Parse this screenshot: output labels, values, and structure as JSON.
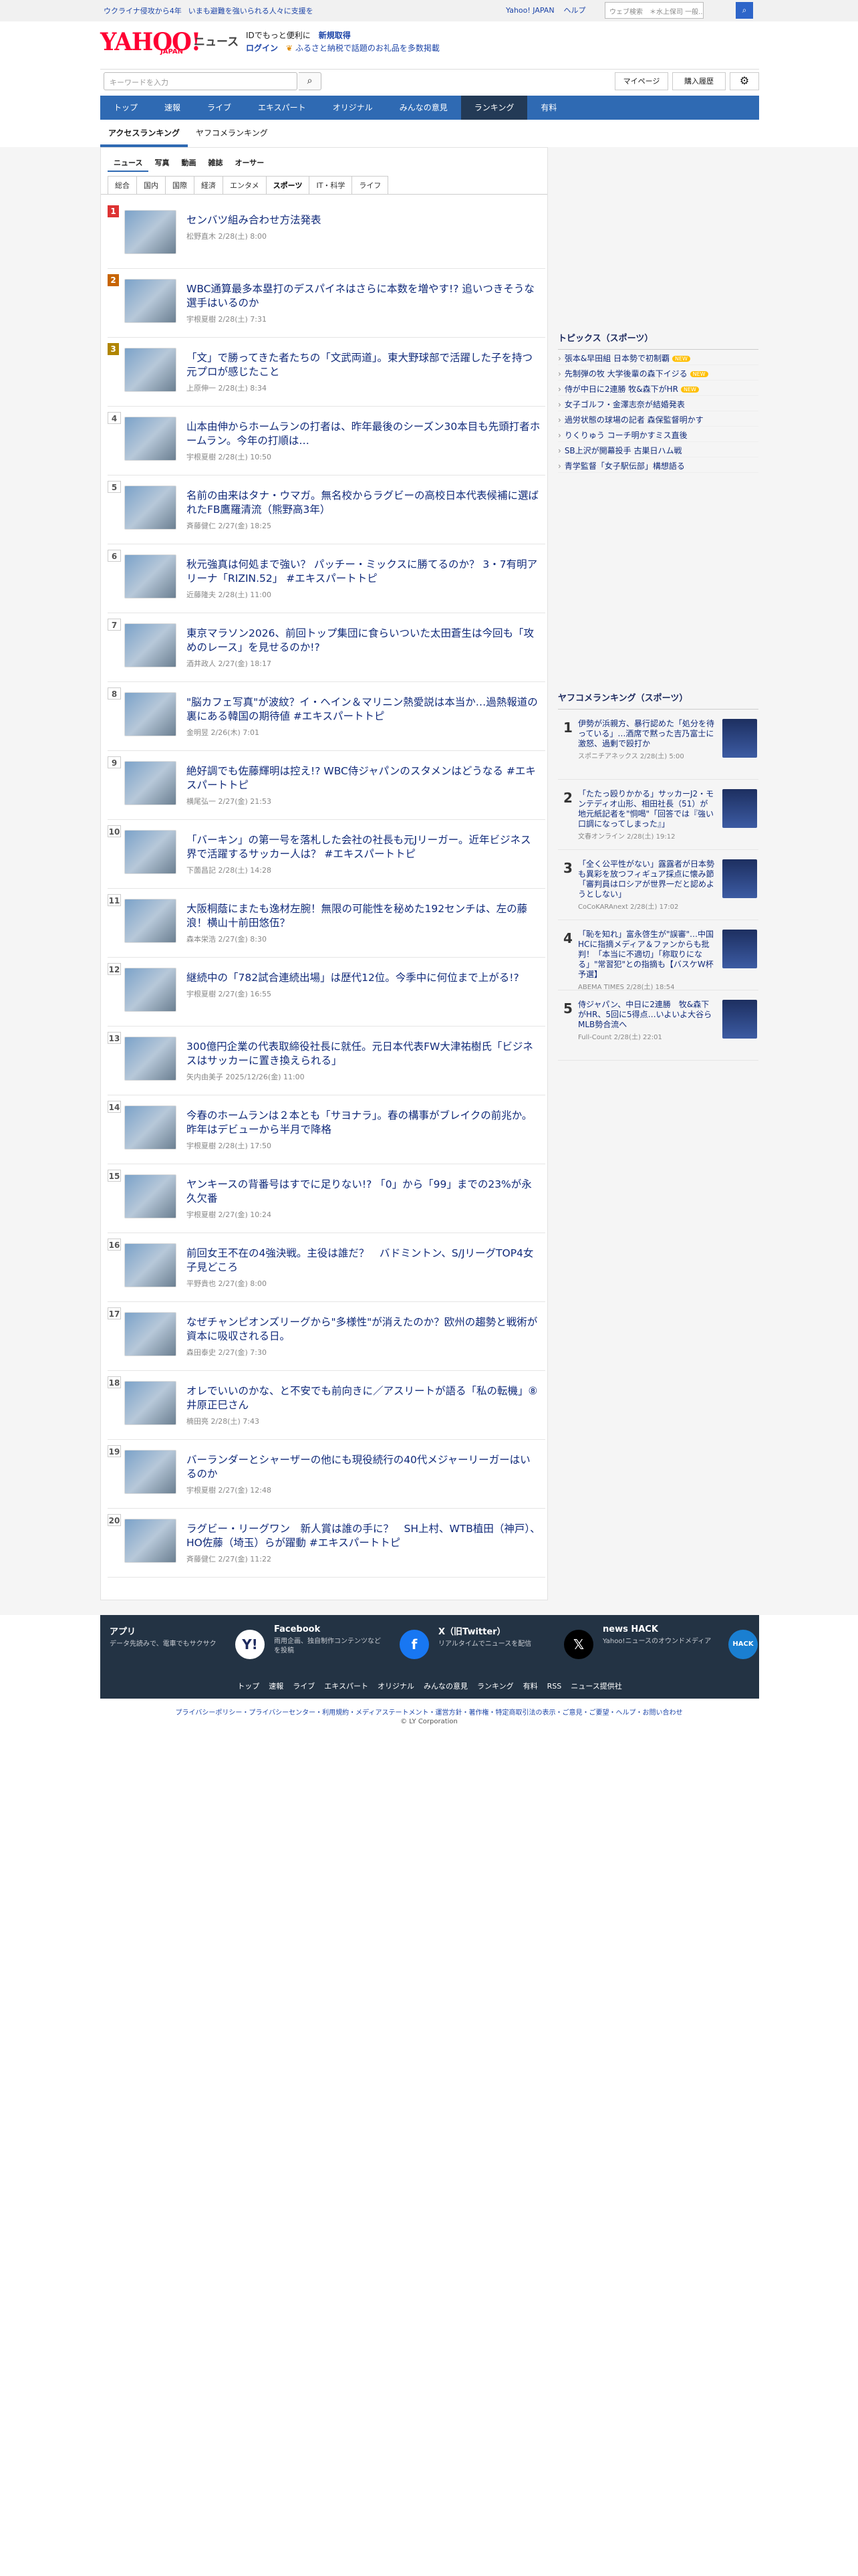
{
  "topbar": {
    "link1": "ウクライナ侵攻から4年",
    "link2": "いまも避難を強いられる人々に支援を",
    "yahoo": "Yahoo! JAPAN",
    "help": "ヘルプ",
    "search_placeholder": "ウェブ検索",
    "search_value": "＊水上保司 一般...",
    "search_icon": "search-icon"
  },
  "header": {
    "logo_text": "YAHOO!",
    "logo_sub": "JAPAN",
    "service": "ニュース",
    "promo1_pre": "IDでもっと便利に",
    "promo1_link": "新規取得",
    "promo2_login": "ログイン",
    "promo2_text": "ふるさと納税で話題のお礼品を多数掲載"
  },
  "search": {
    "placeholder": "キーワードを入力",
    "mypage": "マイページ",
    "history": "購入履歴"
  },
  "nav": [
    "トップ",
    "速報",
    "ライブ",
    "エキスパート",
    "オリジナル",
    "みんなの意見",
    "ランキング",
    "有料"
  ],
  "nav_active": "ランキング",
  "subnav": [
    "アクセスランキング",
    "ヤフコメランキング"
  ],
  "categories": [
    "ニュース",
    "写真",
    "動画",
    "雑誌",
    "オーサー"
  ],
  "genres": [
    "総合",
    "国内",
    "国際",
    "経済",
    "エンタメ",
    "スポーツ",
    "IT・科学",
    "ライフ"
  ],
  "genre_active": "スポーツ",
  "ranking": [
    {
      "rank": "1",
      "title": "センバツ組み合わせ方法発表",
      "meta": "松野直木 2/28(土) 8:00"
    },
    {
      "rank": "2",
      "title": "WBC通算最多本塁打のデスパイネはさらに本数を増やす!? 追いつきそうな選手はいるのか",
      "meta": "宇根夏樹 2/28(土) 7:31"
    },
    {
      "rank": "3",
      "title": "「文」で勝ってきた者たちの「文武両道」。東大野球部で活躍した子を持つ元プロが感じたこと",
      "meta": "上原伸一 2/28(土) 8:34"
    },
    {
      "rank": "4",
      "title": "山本由伸からホームランの打者は、昨年最後のシーズン30本目も先頭打者ホームラン。今年の打順は…",
      "meta": "宇根夏樹 2/28(土) 10:50"
    },
    {
      "rank": "5",
      "title": "名前の由来はタナ・ウマガ。無名校からラグビーの高校日本代表候補に選ばれたFB鷹羅清流（熊野高3年）",
      "meta": "斉藤健仁 2/27(金) 18:25"
    },
    {
      "rank": "6",
      "title": "秋元強真は何処まで強い？ パッチー・ミックスに勝てるのか？ 3・7有明アリーナ「RIZIN.52」 #エキスパートトピ",
      "meta": "近藤隆夫 2/28(土) 11:00"
    },
    {
      "rank": "7",
      "title": "東京マラソン2026、前回トップ集団に食らいついた太田蒼生は今回も「攻めのレース」を見せるのか!?",
      "meta": "酒井政人 2/27(金) 18:17"
    },
    {
      "rank": "8",
      "title": "\"脳カフェ写真\"が波紋？イ・ヘイン＆マリニン熱愛説は本当か…過熱報道の裏にある韓国の期待値 #エキスパートトピ",
      "meta": "金明昱 2/26(木) 7:01"
    },
    {
      "rank": "9",
      "title": "絶好調でも佐藤輝明は控え!? WBC侍ジャパンのスタメンはどうなる #エキスパートトピ",
      "meta": "横尾弘一 2/27(金) 21:53"
    },
    {
      "rank": "10",
      "title": "「バーキン」の第一号を落札した会社の社長も元Jリーガー。近年ビジネス界で活躍するサッカー人は？ #エキスパートトピ",
      "meta": "下薗昌記 2/28(土) 14:28"
    },
    {
      "rank": "11",
      "title": "大阪桐蔭にまたも逸材左腕！無限の可能性を秘めた192センチは、左の藤浪！横山十前田悠伍？",
      "meta": "森本栄浩 2/27(金) 8:30"
    },
    {
      "rank": "12",
      "title": "継続中の「782試合連続出場」は歴代12位。今季中に何位まで上がる!?",
      "meta": "宇根夏樹 2/27(金) 16:55"
    },
    {
      "rank": "13",
      "title": "300億円企業の代表取締役社長に就任。元日本代表FW大津祐樹氏「ビジネスはサッカーに置き換えられる」",
      "meta": "矢内由美子 2025/12/26(金) 11:00"
    },
    {
      "rank": "14",
      "title": "今春のホームランは２本とも「サヨナラ」。春の構事がブレイクの前兆か。昨年はデビューから半月で降格",
      "meta": "宇根夏樹 2/28(土) 17:50"
    },
    {
      "rank": "15",
      "title": "ヤンキースの背番号はすでに足りない!? 「0」から「99」までの23%が永久欠番",
      "meta": "宇根夏樹 2/27(金) 10:24"
    },
    {
      "rank": "16",
      "title": "前回女王不在の4強決戦。主役は誰だ？　バドミントン、S/JリーグTOP4女子見どころ",
      "meta": "平野貴也 2/27(金) 8:00"
    },
    {
      "rank": "17",
      "title": "なぜチャンピオンズリーグから\"多様性\"が消えたのか？欧州の趨勢と戦術が資本に吸収される日。",
      "meta": "森田泰史 2/27(金) 7:30"
    },
    {
      "rank": "18",
      "title": "オレでいいのかな、と不安でも前向きに／アスリートが語る「私の転機」⑧井原正巳さん",
      "meta": "楠田亮 2/28(土) 7:43"
    },
    {
      "rank": "19",
      "title": "バーランダーとシャーザーの他にも現役続行の40代メジャーリーガーはいるのか",
      "meta": "宇根夏樹 2/27(金) 12:48"
    },
    {
      "rank": "20",
      "title": "ラグビー・リーグワン　新人賞は誰の手に？　SH上村、WTB植田（神戸）、HO佐藤（埼玉）らが躍動 #エキスパートトピ",
      "meta": "斉藤健仁 2/27(金) 11:22"
    }
  ],
  "topics": {
    "heading": "トピックス（スポーツ）",
    "items": [
      {
        "text": "張本&早田組 日本勢で初制覇",
        "new": "NEW"
      },
      {
        "text": "先制弾の牧 大学後輩の森下イジる",
        "new": "NEW"
      },
      {
        "text": "侍が中日に2連勝 牧&森下がHR",
        "new": "NEW"
      },
      {
        "text": "女子ゴルフ・金澤志奈が結婚発表",
        "new": ""
      },
      {
        "text": "過労状態の球場の記者 森保監督明かす",
        "new": ""
      },
      {
        "text": "りくりゅう コーチ明かすミス直後",
        "new": ""
      },
      {
        "text": "SB上沢が開幕投手 古巣日ハム戦",
        "new": ""
      },
      {
        "text": "青学監督「女子駅伝部」構想語る",
        "new": ""
      }
    ]
  },
  "yahookome": {
    "heading": "ヤフコメランキング（スポーツ）",
    "items": [
      {
        "rank": "1",
        "title": "伊勢が浜親方、暴行認めた「処分を待っている」…酒席で黙った吉乃富士に激怒、過剰で殴打か",
        "meta": "スポニチアネックス 2/28(土) 5:00"
      },
      {
        "rank": "2",
        "title": "「たたっ殴りかかる」サッカーJ2・モンテディオ山形、相田社長（51）が地元紙記者を\"恫喝\"「回答では『強い口調になってしまった』」",
        "meta": "文春オンライン 2/28(土) 19:12"
      },
      {
        "rank": "3",
        "title": "「全く公平性がない」露露者が日本勢も異彩を放つフィギュア採点に懐み節「審判員はロシアが世界一だと認めようとしない」",
        "meta": "CoCoKARAnext 2/28(土) 17:02"
      },
      {
        "rank": "4",
        "title": "「恥を知れ」富永啓生が\"誤審\"…中国HCに指摘メディア＆ファンからも批判！「本当に不適切」「称取りになる」\"常習犯\"との指摘も【バスケW杯予選】",
        "meta": "ABEMA TIMES 2/28(土) 18:54"
      },
      {
        "rank": "5",
        "title": "侍ジャパン、中日に2連勝　牧&森下がHR、5回に5得点…いよいよ大谷らMLB勢合流へ",
        "meta": "Full-Count 2/28(土) 22:01"
      }
    ]
  },
  "footer": {
    "apps": [
      {
        "name": "アプリ",
        "desc": "データ先読みで、電車でもサクサク",
        "icon": "Y!"
      },
      {
        "name": "Facebook",
        "desc": "雨用企画、独自制作コンテンツなどを投稿",
        "icon": "f"
      },
      {
        "name": "X（旧Twitter）",
        "desc": "リアルタイムでニュースを配信",
        "icon": "𝕏"
      },
      {
        "name": "news HACK",
        "desc": "Yahoo!ニュースのオウンドメディア",
        "icon": "HACK"
      }
    ],
    "links": [
      "トップ",
      "速報",
      "ライブ",
      "エキスパート",
      "オリジナル",
      "みんなの意見",
      "ランキング",
      "有料",
      "RSS",
      "ニュース提供社"
    ],
    "legal": "プライバシーポリシー・プライバシーセンター・利用規約・メディアステートメント・運営方針・著作権・特定商取引法の表示・ご意見・ご要望・ヘルプ・お問い合わせ",
    "copyright": "© LY Corporation"
  },
  "colors": {
    "brand": "#ff0033",
    "nav": "#2f6ab3",
    "nav_active": "#233a56",
    "link": "#102a7a",
    "footer": "#233344"
  }
}
